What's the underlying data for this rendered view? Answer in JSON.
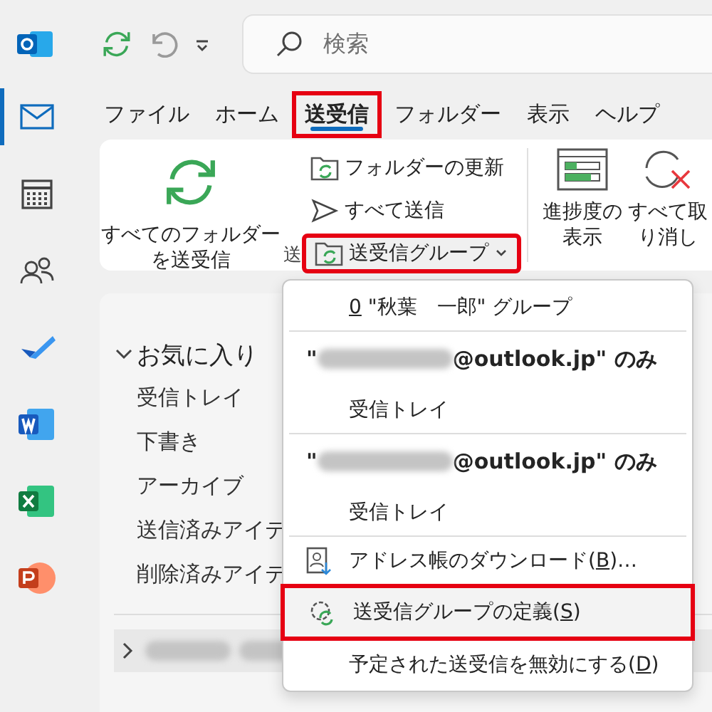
{
  "search": {
    "placeholder": "検索"
  },
  "rail": [
    {
      "kind": "mail",
      "selected": true
    },
    {
      "kind": "calendar",
      "selected": false
    },
    {
      "kind": "people",
      "selected": false
    },
    {
      "kind": "todo",
      "selected": false
    },
    {
      "kind": "word",
      "selected": false
    },
    {
      "kind": "excel",
      "selected": false
    },
    {
      "kind": "powerpoint",
      "selected": false
    }
  ],
  "tabs": [
    {
      "label": "ファイル",
      "selected": false,
      "highlighted": false
    },
    {
      "label": "ホーム",
      "selected": false,
      "highlighted": false
    },
    {
      "label": "送受信",
      "selected": true,
      "highlighted": true
    },
    {
      "label": "フォルダー",
      "selected": false,
      "highlighted": false
    },
    {
      "label": "表示",
      "selected": false,
      "highlighted": false
    },
    {
      "label": "ヘルプ",
      "selected": false,
      "highlighted": false
    }
  ],
  "ribbon": {
    "big_button": {
      "label": "すべてのフォルダーを送受信"
    },
    "small_buttons": [
      {
        "kind": "refresh",
        "label": "フォルダーの更新",
        "highlighted": false
      },
      {
        "kind": "send",
        "label": "すべて送信",
        "highlighted": false
      },
      {
        "kind": "group",
        "label": "送受信グループ",
        "highlighted": true
      }
    ],
    "group_label": "送",
    "right_buttons": [
      {
        "kind": "progress",
        "label": "進捗度の表示"
      },
      {
        "kind": "cancel",
        "label": "すべて取り消し"
      }
    ]
  },
  "folders": {
    "header": "お気に入り",
    "expanded": true,
    "items": [
      "受信トレイ",
      "下書き",
      "アーカイブ",
      "送信済みアイテ",
      "削除済みアイテ"
    ],
    "account_expanded": false
  },
  "menu": [
    {
      "kind": "item",
      "key": "0",
      "after": " \"秋葉　一郎\" グループ",
      "highlighted": false
    },
    {
      "kind": "separator"
    },
    {
      "kind": "account",
      "before": "\"",
      "after": "@outlook.jp\" のみ"
    },
    {
      "kind": "item",
      "before": "受信トレイ",
      "highlighted": false
    },
    {
      "kind": "separator"
    },
    {
      "kind": "account",
      "before": "\"",
      "after": "@outlook.jp\" のみ"
    },
    {
      "kind": "item",
      "before": "受信トレイ",
      "highlighted": false
    },
    {
      "kind": "separator"
    },
    {
      "kind": "download",
      "before": "アドレス帳のダウンロード(",
      "key": "B",
      "after": ")…",
      "highlighted": false
    },
    {
      "kind": "define",
      "before": "送受信グループの定義(",
      "key": "S",
      "after": ")",
      "highlighted": true
    },
    {
      "kind": "item",
      "before": "予定された送受信を無効にする(",
      "key": "D",
      "after": ")",
      "highlighted": false
    }
  ]
}
